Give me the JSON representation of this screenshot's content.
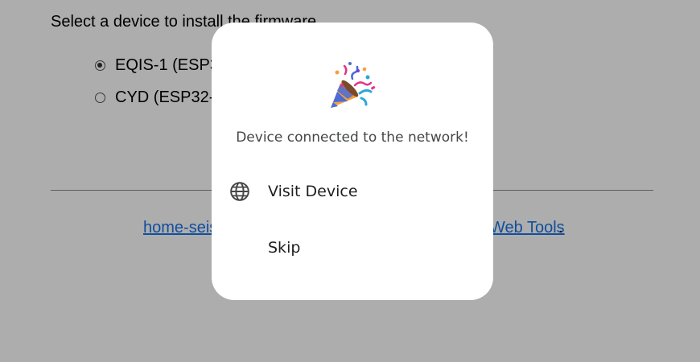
{
  "background_page": {
    "intro_text": "Select a device to install the firmware",
    "devices": [
      {
        "label": "EQIS-1 (ESP32",
        "checked": true
      },
      {
        "label": "CYD (ESP32-S",
        "checked": false
      }
    ],
    "footer": {
      "link_left": "home-seis",
      "link_right": "Web Tools",
      "period": "."
    }
  },
  "dialog": {
    "icon": "party-popper-icon",
    "message": "Device connected to the network!",
    "items": [
      {
        "label": "Visit Device",
        "icon": "globe-icon"
      },
      {
        "label": "Skip",
        "icon": ""
      }
    ]
  },
  "colors": {
    "scrim": "rgba(0,0,0,0.32)",
    "link": "#1a73e8",
    "dialog_bg": "#ffffff"
  }
}
